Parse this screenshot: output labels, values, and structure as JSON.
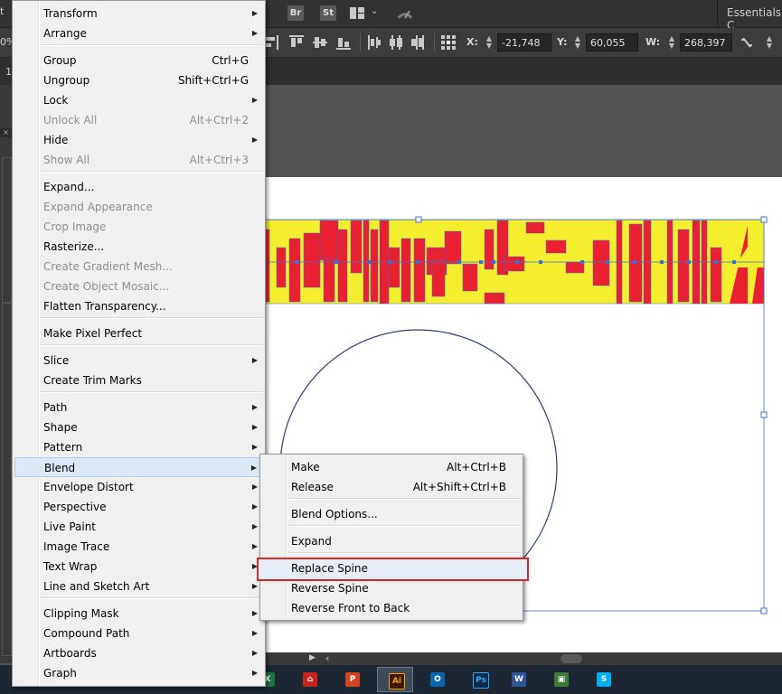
{
  "appbar": {
    "left_fragment": "t",
    "bridge_label": "Br",
    "stock_label": "St",
    "workspace_label": "Essentials C"
  },
  "controlbar": {
    "zoom_fragment": "0%",
    "x_label": "X:",
    "x_value": "-21,748 mm",
    "y_label": "Y:",
    "y_value": "60,055 mm",
    "w_label": "W:",
    "w_value": "268,397 mm"
  },
  "tabbar": {
    "doc_fragment": "1"
  },
  "object_menu": {
    "items": [
      {
        "label": "Transform",
        "shortcut": "",
        "submenu": true,
        "disabled": false
      },
      {
        "label": "Arrange",
        "shortcut": "",
        "submenu": true,
        "disabled": false
      },
      {
        "label": "Group",
        "shortcut": "Ctrl+G",
        "submenu": false,
        "disabled": false
      },
      {
        "label": "Ungroup",
        "shortcut": "Shift+Ctrl+G",
        "submenu": false,
        "disabled": false
      },
      {
        "label": "Lock",
        "shortcut": "",
        "submenu": true,
        "disabled": false
      },
      {
        "label": "Unlock All",
        "shortcut": "Alt+Ctrl+2",
        "submenu": false,
        "disabled": true
      },
      {
        "label": "Hide",
        "shortcut": "",
        "submenu": true,
        "disabled": false
      },
      {
        "label": "Show All",
        "shortcut": "Alt+Ctrl+3",
        "submenu": false,
        "disabled": true
      },
      {
        "label": "Expand...",
        "shortcut": "",
        "submenu": false,
        "disabled": false
      },
      {
        "label": "Expand Appearance",
        "shortcut": "",
        "submenu": false,
        "disabled": true
      },
      {
        "label": "Crop Image",
        "shortcut": "",
        "submenu": false,
        "disabled": true
      },
      {
        "label": "Rasterize...",
        "shortcut": "",
        "submenu": false,
        "disabled": false
      },
      {
        "label": "Create Gradient Mesh...",
        "shortcut": "",
        "submenu": false,
        "disabled": true
      },
      {
        "label": "Create Object Mosaic...",
        "shortcut": "",
        "submenu": false,
        "disabled": true
      },
      {
        "label": "Flatten Transparency...",
        "shortcut": "",
        "submenu": false,
        "disabled": false
      },
      {
        "label": "Make Pixel Perfect",
        "shortcut": "",
        "submenu": false,
        "disabled": false
      },
      {
        "label": "Slice",
        "shortcut": "",
        "submenu": true,
        "disabled": false
      },
      {
        "label": "Create Trim Marks",
        "shortcut": "",
        "submenu": false,
        "disabled": false
      },
      {
        "label": "Path",
        "shortcut": "",
        "submenu": true,
        "disabled": false
      },
      {
        "label": "Shape",
        "shortcut": "",
        "submenu": true,
        "disabled": false
      },
      {
        "label": "Pattern",
        "shortcut": "",
        "submenu": true,
        "disabled": false
      },
      {
        "label": "Blend",
        "shortcut": "",
        "submenu": true,
        "disabled": false,
        "highlighted": true
      },
      {
        "label": "Envelope Distort",
        "shortcut": "",
        "submenu": true,
        "disabled": false
      },
      {
        "label": "Perspective",
        "shortcut": "",
        "submenu": true,
        "disabled": false
      },
      {
        "label": "Live Paint",
        "shortcut": "",
        "submenu": true,
        "disabled": false
      },
      {
        "label": "Image Trace",
        "shortcut": "",
        "submenu": true,
        "disabled": false
      },
      {
        "label": "Text Wrap",
        "shortcut": "",
        "submenu": true,
        "disabled": false
      },
      {
        "label": "Line and Sketch Art",
        "shortcut": "",
        "submenu": true,
        "disabled": false
      },
      {
        "label": "Clipping Mask",
        "shortcut": "",
        "submenu": true,
        "disabled": false
      },
      {
        "label": "Compound Path",
        "shortcut": "",
        "submenu": true,
        "disabled": false
      },
      {
        "label": "Artboards",
        "shortcut": "",
        "submenu": true,
        "disabled": false
      },
      {
        "label": "Graph",
        "shortcut": "",
        "submenu": true,
        "disabled": false
      }
    ]
  },
  "blend_menu": {
    "items": [
      {
        "label": "Make",
        "shortcut": "Alt+Ctrl+B",
        "disabled": false
      },
      {
        "label": "Release",
        "shortcut": "Alt+Shift+Ctrl+B",
        "disabled": false
      },
      {
        "label": "Blend Options...",
        "shortcut": "",
        "disabled": false
      },
      {
        "label": "Expand",
        "shortcut": "",
        "disabled": false
      },
      {
        "label": "Replace Spine",
        "shortcut": "",
        "disabled": false,
        "outlined": true
      },
      {
        "label": "Reverse Spine",
        "shortcut": "",
        "disabled": false
      },
      {
        "label": "Reverse Front to Back",
        "shortcut": "",
        "disabled": false
      }
    ]
  },
  "taskbar": {
    "items": [
      {
        "icon": "excel-icon",
        "glyph": "X",
        "color": "#1f7244"
      },
      {
        "icon": "acrobat-icon",
        "glyph": "⌂",
        "color": "#c4241b"
      },
      {
        "icon": "powerpoint-icon",
        "glyph": "P",
        "color": "#d04423"
      },
      {
        "icon": "illustrator-icon",
        "glyph": "Ai",
        "color": "#3a1a04",
        "active": true
      },
      {
        "icon": "outlook-icon",
        "glyph": "O",
        "color": "#0a64b0"
      },
      {
        "icon": "photoshop-icon",
        "glyph": "Ps",
        "color": "#0b2a45"
      },
      {
        "icon": "word-icon",
        "glyph": "W",
        "color": "#2b5797"
      },
      {
        "icon": "remote-desktop-icon",
        "glyph": "▣",
        "color": "#3b7a3b"
      },
      {
        "icon": "skype-icon",
        "glyph": "S",
        "color": "#00aff0"
      }
    ]
  },
  "colors": {
    "art_yellow": "#f5ee2e",
    "art_red": "#e8202f",
    "selection_blue": "#3b6fd1",
    "menu_outline_red": "#d9252a"
  }
}
